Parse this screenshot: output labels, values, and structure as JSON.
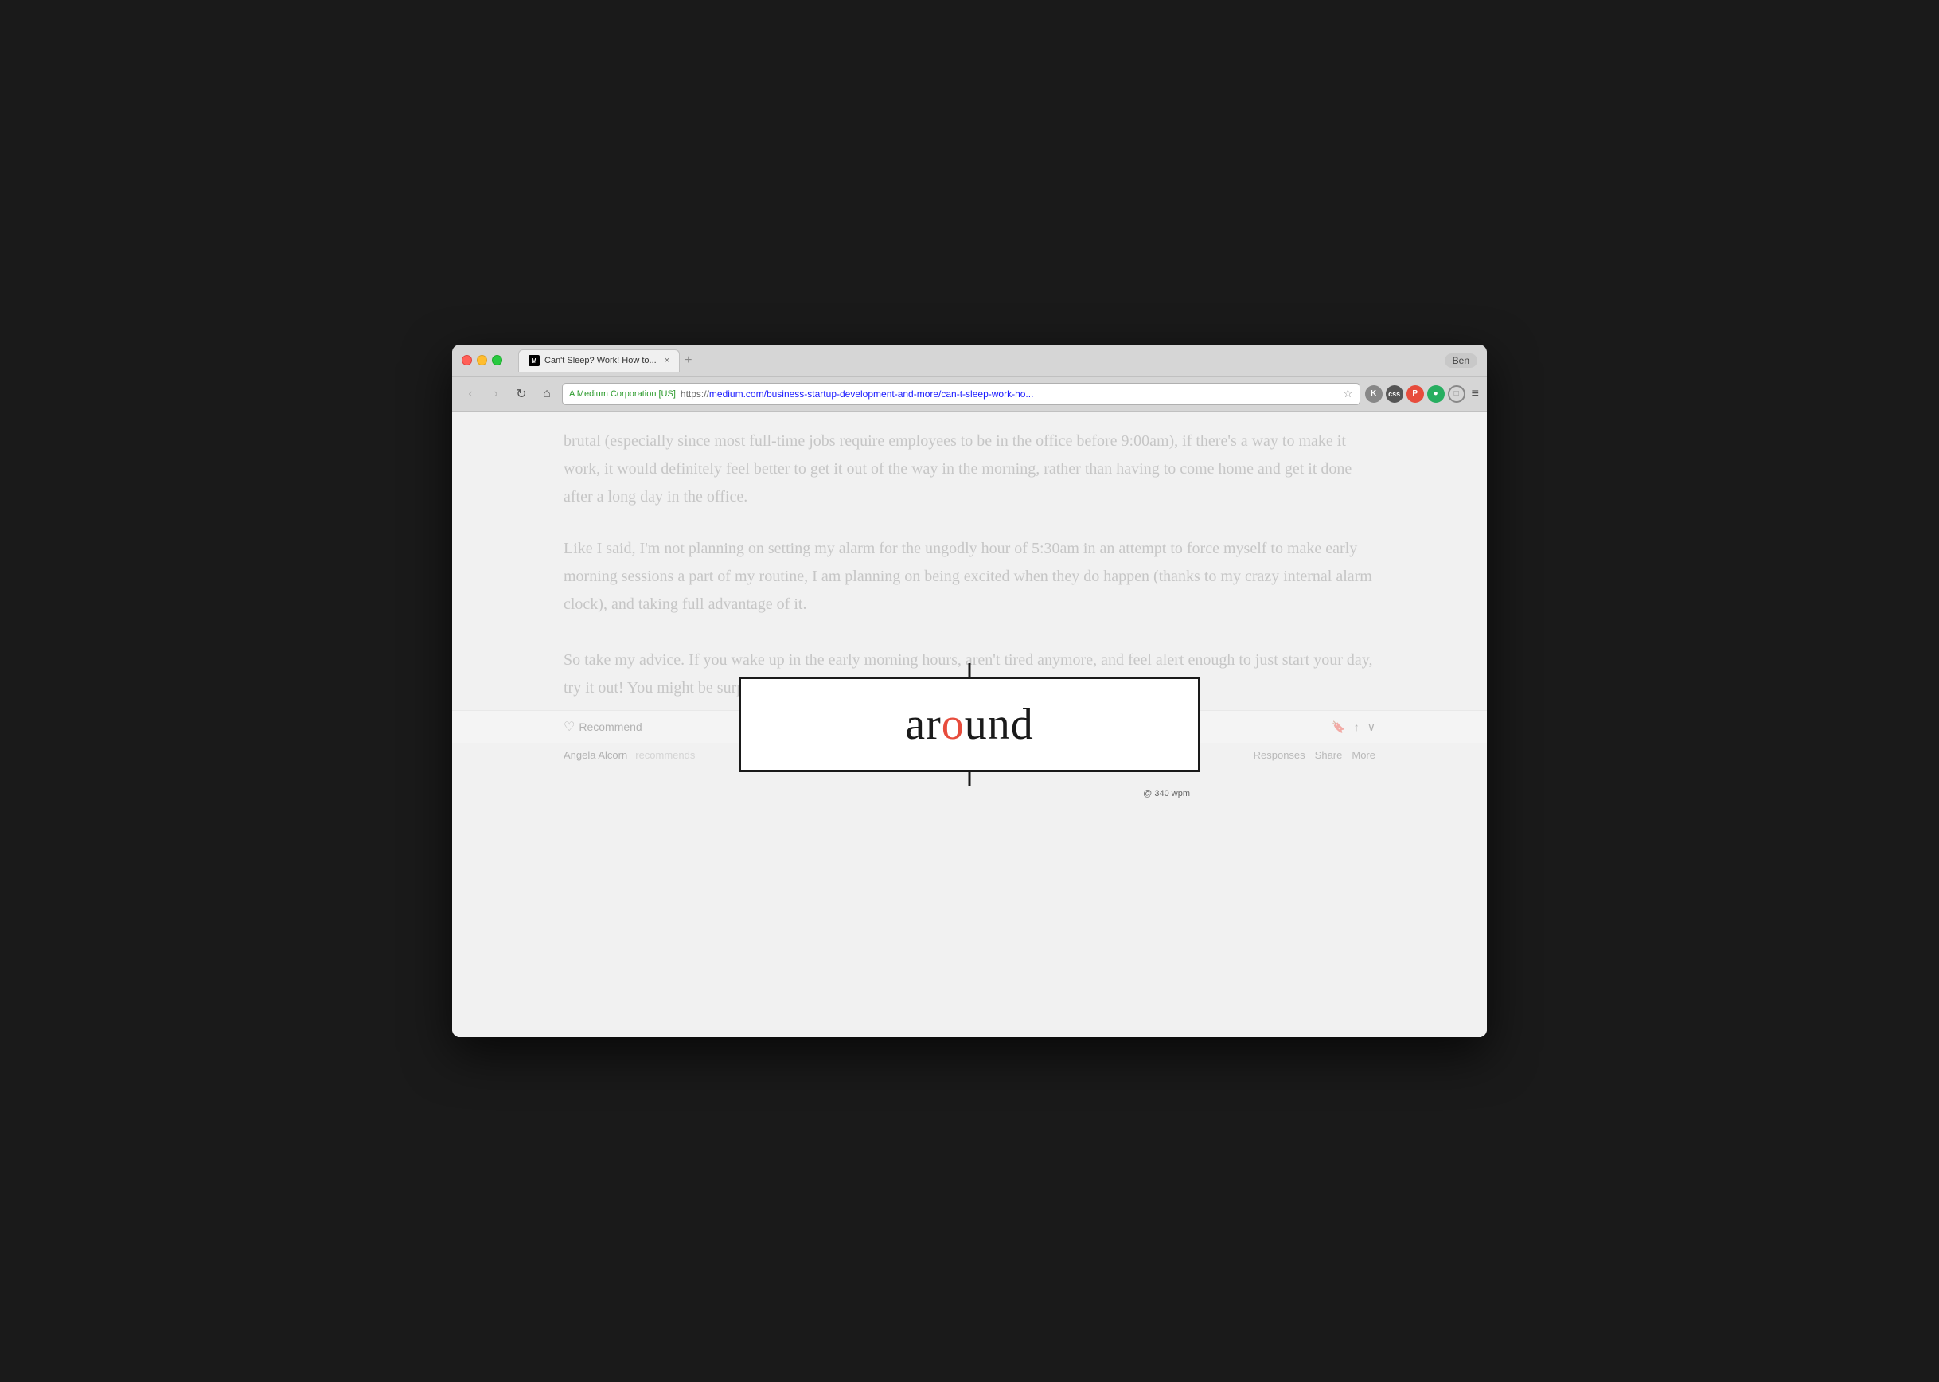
{
  "browser": {
    "profile": "Ben",
    "tab": {
      "favicon": "M",
      "label": "Can't Sleep? Work! How to...",
      "close": "×"
    },
    "new_tab": "+",
    "toolbar": {
      "back": "‹",
      "forward": "›",
      "refresh": "↻",
      "home": "⌂",
      "ssl_label": "A Medium Corporation [US]",
      "url_https": "https://",
      "url_domain": "medium.com",
      "url_path": "/business-startup-development-and-more/can-t-sleep-work-ho...",
      "star": "☆",
      "extensions": {
        "pocket": "P",
        "css": "css",
        "producthunt": "P",
        "dot1": "●",
        "ghost": "□"
      },
      "menu": "≡"
    }
  },
  "page": {
    "paragraph1": "brutal (especially since most full-time jobs require employees to be in the office before 9:00am), if there's a way to make it work, it would definitely feel better to get it out of the way in the morning, rather than having to come home and get it done after a long day in the office.",
    "paragraph2": "Like I said, I'm not planning on setting my alarm for the ungodly hour of 5:30am in an attempt to force myself to make early morning sessions a part of my routine, I am planning on being excited when they do happen (thanks to my crazy internal alarm clock), and taking full advantage of it.",
    "paragraph3": "So take my advice. If you wake up in the early morning hours, aren't tired anymore, and feel alert enough to just start your day, try it out! You might be surprised at how productive you end up being."
  },
  "speed_reader": {
    "word_before": "ar",
    "word_focus": "o",
    "word_after": "und",
    "wpm": "@ 340 wpm"
  },
  "action_bar": {
    "recommend_label": "Recommend",
    "bookmark_icon": "🔖",
    "share_icon": "↑",
    "more_icon": "∨"
  },
  "author_section": {
    "name": "Angela Alcorn",
    "action": "recommends",
    "responses": "Responses",
    "share": "Share",
    "more": "More"
  }
}
